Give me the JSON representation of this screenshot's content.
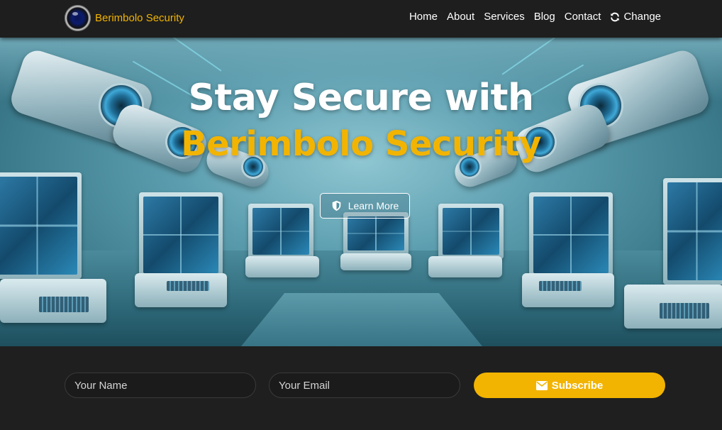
{
  "navbar": {
    "brand": "Berimbolo Security",
    "links": [
      "Home",
      "About",
      "Services",
      "Blog",
      "Contact"
    ],
    "change_label": "Change",
    "icons": {
      "logo": "camera-lens-logo",
      "change": "sync-icon"
    }
  },
  "hero": {
    "title_line1": "Stay Secure with",
    "title_line2": "Berimbolo Security",
    "button_label": "Learn More",
    "button_icon": "shield-icon"
  },
  "subscribe": {
    "name_placeholder": "Your Name",
    "email_placeholder": "Your Email",
    "button_label": "Subscribe",
    "button_icon": "envelope-icon"
  },
  "colors": {
    "accent": "#f2b400",
    "nav_bg": "#1e1e1e",
    "footer_bg": "#1f1f1f"
  }
}
